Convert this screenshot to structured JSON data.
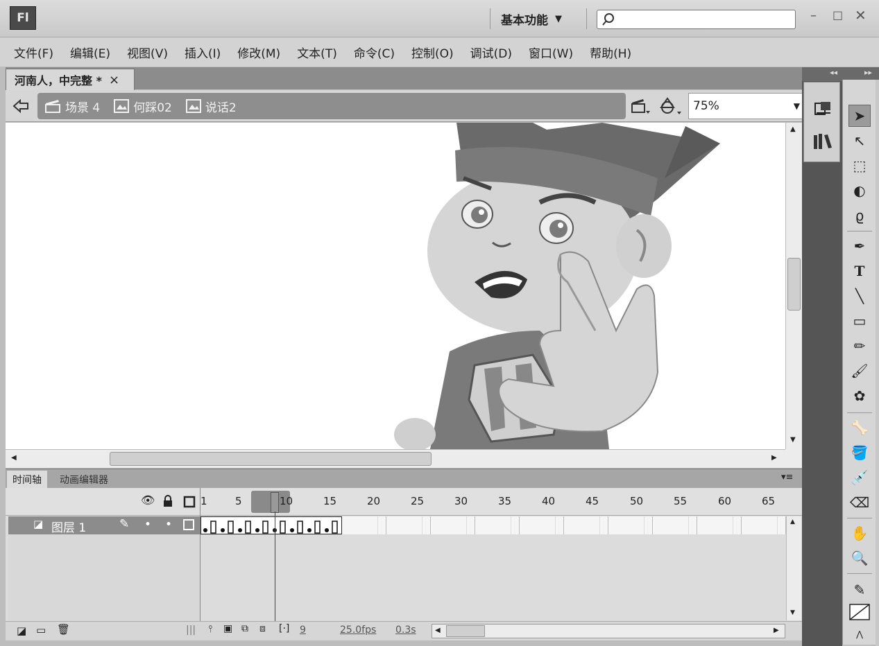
{
  "app": {
    "logo": "Fl"
  },
  "titlebar": {
    "workspace_label": "基本功能",
    "search_placeholder": "",
    "min": "–",
    "max": "□",
    "close": "✕"
  },
  "menu": [
    "文件(F)",
    "编辑(E)",
    "视图(V)",
    "插入(I)",
    "修改(M)",
    "文本(T)",
    "命令(C)",
    "控制(O)",
    "调试(D)",
    "窗口(W)",
    "帮助(H)"
  ],
  "document": {
    "tab_title": "河南人，中完整 *",
    "close": "×"
  },
  "editbar": {
    "breadcrumbs": [
      {
        "label": "场景 4",
        "icon": "scene-icon"
      },
      {
        "label": "何踩02",
        "icon": "symbol-icon"
      },
      {
        "label": "说话2",
        "icon": "symbol-icon"
      }
    ],
    "zoom": "75%"
  },
  "timeline": {
    "tabs": [
      "时间轴",
      "动画编辑器"
    ],
    "frame_numbers": [
      "1",
      "5",
      "10",
      "15",
      "20",
      "25",
      "30",
      "35",
      "40",
      "45",
      "50",
      "55",
      "60",
      "65"
    ],
    "layer_name": "图层 1",
    "current_frame": "9",
    "fps": "25.0fps",
    "elapsed": "0.3s"
  },
  "colors": {
    "bg_chrome": "#d3d3d3",
    "dark_chrome": "#8c8c8c",
    "stage": "#ffffff"
  }
}
